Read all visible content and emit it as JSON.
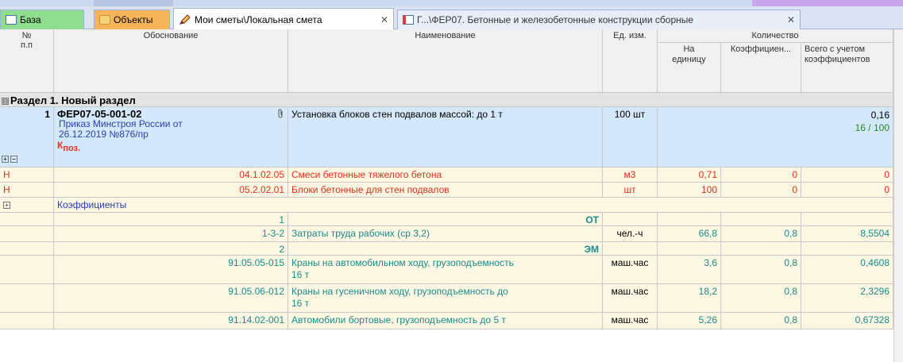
{
  "tabs": [
    {
      "label": "База",
      "icon": "table-icon",
      "close": ""
    },
    {
      "label": "Объекты",
      "icon": "folder-icon",
      "close": ""
    },
    {
      "label": "Мои сметы\\Локальная смета",
      "icon": "pencil-icon",
      "close": "✕"
    },
    {
      "label": "Г...\\ФЕР07. Бетонные и железобетонные конструкции сборные",
      "icon": "table-icon",
      "close": "✕"
    }
  ],
  "header": {
    "num": "№\nп.п",
    "basis": "Обоснование",
    "name": "Наименование",
    "unit": "Ед. изм.",
    "quantity": "Количество",
    "per_unit": "На\nединицу",
    "coef": "Коэффициен...",
    "total": "Всего с учетом\nкоэффициентов"
  },
  "section": {
    "toggle": "⊟",
    "title": "Раздел 1. Новый раздел"
  },
  "position": {
    "num": "1",
    "code": "ФЕР07-05-001-02",
    "order": "Приказ Минстроя России от\n26.12.2019 №876/пр",
    "mark": "К",
    "mark_sub": "поз.",
    "name": "Установка блоков стен подвалов массой: до 1 т",
    "unit": "100 шт",
    "total": "0,16",
    "ratio": "16 / 100"
  },
  "materials": [
    {
      "type": "Н",
      "code": "04.1.02.05",
      "name": "Смеси бетонные тяжелого бетона",
      "unit": "м3",
      "per_unit": "0,71",
      "coef": "0",
      "total": "0"
    },
    {
      "type": "Н",
      "code": "05.2.02.01",
      "name": "Блоки бетонные для стен подвалов",
      "unit": "шт",
      "per_unit": "100",
      "coef": "0",
      "total": "0"
    }
  ],
  "coefficients_label": "Коэффициенты",
  "resources": [
    {
      "code": "1",
      "name": "ОТ",
      "unit": "",
      "per_unit": "",
      "coef": "",
      "total": "",
      "kind": "group"
    },
    {
      "code": "1-3-2",
      "name": "Затраты труда рабочих (ср 3,2)",
      "unit": "чел.-ч",
      "per_unit": "66,8",
      "coef": "0,8",
      "total": "8,5504",
      "kind": "item"
    },
    {
      "code": "2",
      "name": "ЭМ",
      "unit": "",
      "per_unit": "",
      "coef": "",
      "total": "",
      "kind": "group"
    },
    {
      "code": "91.05.05-015",
      "name": "Краны на автомобильном ходу, грузоподъемность\n16 т",
      "unit": "маш.час",
      "per_unit": "3,6",
      "coef": "0,8",
      "total": "0,4608",
      "kind": "item"
    },
    {
      "code": "91.05.06-012",
      "name": "Краны на гусеничном ходу, грузоподъемность до\n16 т",
      "unit": "маш.час",
      "per_unit": "18,2",
      "coef": "0,8",
      "total": "2,3296",
      "kind": "item"
    },
    {
      "code": "91.14.02-001",
      "name": "Автомобили бортовые, грузоподъемность до 5 т",
      "unit": "маш.час",
      "per_unit": "5,26",
      "coef": "0,8",
      "total": "0,67328",
      "kind": "item"
    }
  ],
  "colors": {
    "position_bg": "#d4e8fb",
    "material_text": "#e0301e",
    "resource_text": "#1c8b8b",
    "section_bg": "#e4e4e4"
  }
}
